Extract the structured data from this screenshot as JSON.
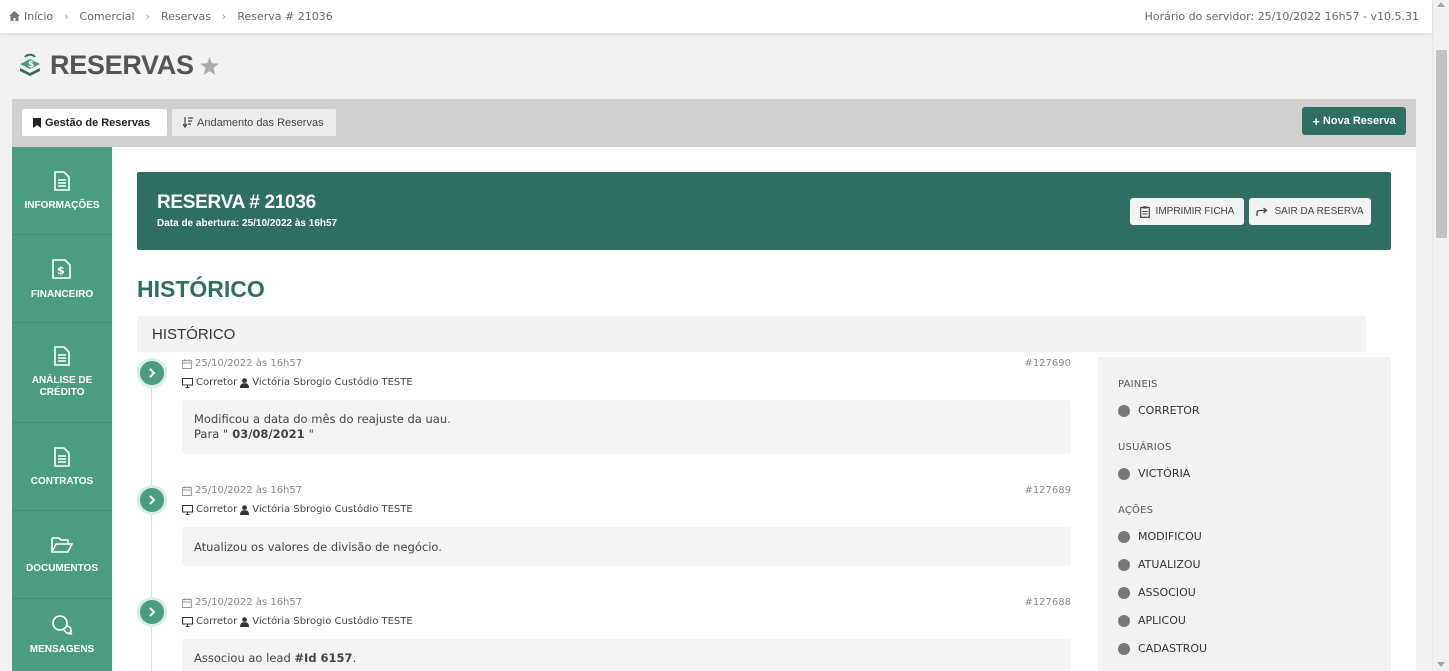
{
  "breadcrumb": {
    "items": [
      "Início",
      "Comercial",
      "Reservas",
      "Reserva # 21036"
    ]
  },
  "server_info": "Horário do servidor: 25/10/2022 16h57 - v10.5.31",
  "page": {
    "title": "RESERVAS"
  },
  "tabs": [
    {
      "label": "Gestão de Reservas",
      "active": true
    },
    {
      "label": "Andamento das Reservas",
      "active": false
    }
  ],
  "new_button": "Nova Reserva",
  "sidebar": {
    "items": [
      {
        "label": "INFORMAÇÕES",
        "icon": "document-icon"
      },
      {
        "label": "FINANCEIRO",
        "icon": "money-document-icon"
      },
      {
        "label": "ANÁLISE DE CRÉDITO",
        "icon": "document-icon"
      },
      {
        "label": "CONTRATOS",
        "icon": "document-icon"
      },
      {
        "label": "DOCUMENTOS",
        "icon": "folder-open-icon"
      },
      {
        "label": "MENSAGENS",
        "icon": "chat-icon"
      }
    ]
  },
  "reserva": {
    "title": "RESERVA # 21036",
    "subtitle": "Data de abertura: 25/10/2022 às 16h57",
    "print_label": "IMPRIMIR FICHA",
    "exit_label": "SAIR DA RESERVA"
  },
  "historico": {
    "heading": "HISTÓRICO",
    "section_label": "HISTÓRICO",
    "entries": [
      {
        "date": "25/10/2022 às 16h57",
        "id": "#127690",
        "panel": "Corretor",
        "user": "Victória Sbrogio Custódio TESTE",
        "line1": "Modificou a data do mês do reajuste da uau.",
        "line2_prefix": "Para \"",
        "line2_value": " 03/08/2021 ",
        "line2_suffix": "\""
      },
      {
        "date": "25/10/2022 às 16h57",
        "id": "#127689",
        "panel": "Corretor",
        "user": "Victória Sbrogio Custódio TESTE",
        "line1": "Atualizou os valores de divisão de negócio."
      },
      {
        "date": "25/10/2022 às 16h57",
        "id": "#127688",
        "panel": "Corretor",
        "user": "Victória Sbrogio Custódio TESTE",
        "line1_prefix": "Associou ao lead ",
        "line1_value": "#Id 6157",
        "line1_suffix": "."
      }
    ]
  },
  "filters": {
    "paineis": {
      "label": "PAINEIS",
      "items": [
        "CORRETOR"
      ]
    },
    "usuarios": {
      "label": "USUÁRIOS",
      "items": [
        "VICTÓRIA"
      ]
    },
    "acoes": {
      "label": "AÇÕES",
      "items": [
        "MODIFICOU",
        "ATUALIZOU",
        "ASSOCIOU",
        "APLICOU",
        "CADASTROU"
      ]
    }
  },
  "colors": {
    "brand_dark": "#2f6e63",
    "brand_green": "#4a9e7f"
  }
}
